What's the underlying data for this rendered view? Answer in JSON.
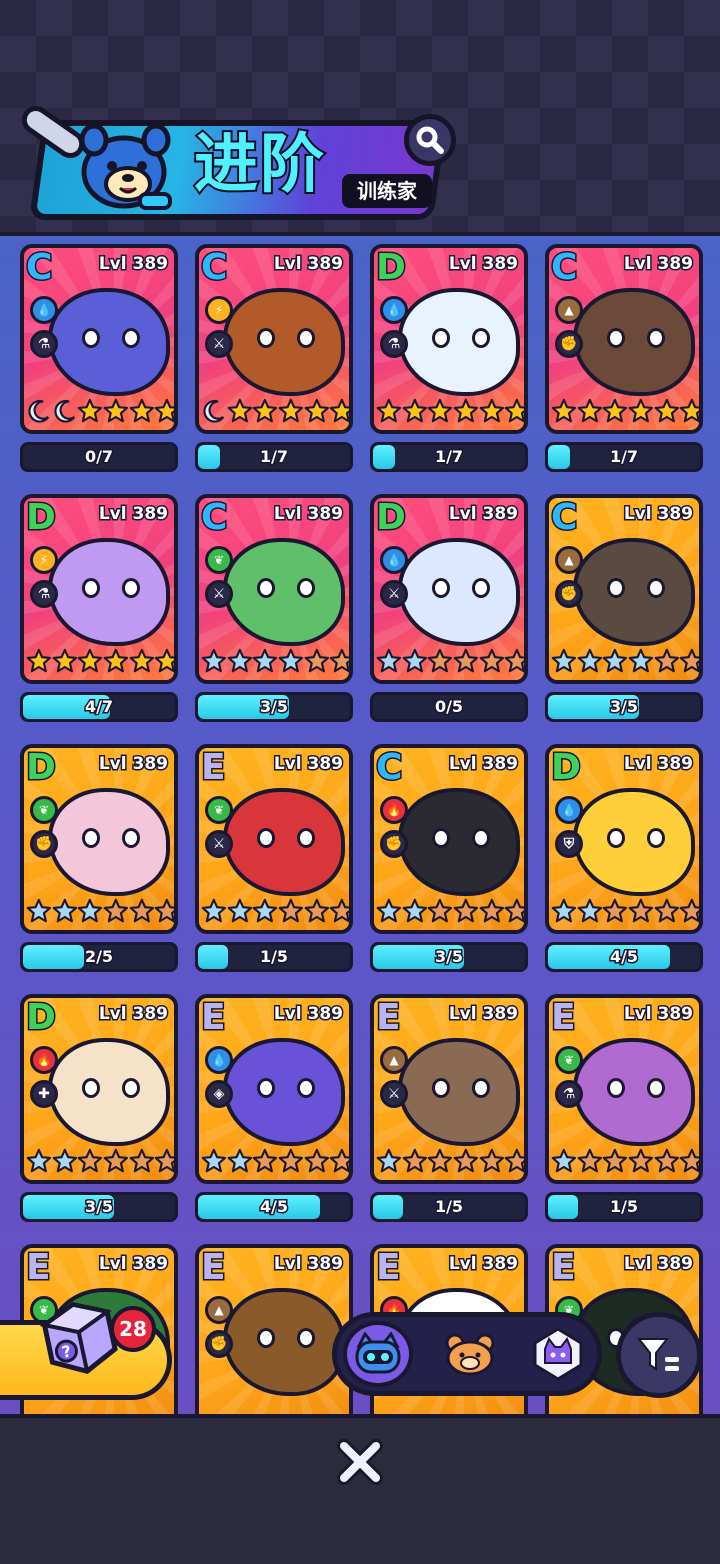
{
  "header": {
    "title": "进阶",
    "subtitle": "训练家",
    "search_icon": "search-icon"
  },
  "colors": {
    "rank_C": "#2fb6ff",
    "rank_D": "#3ed25a",
    "rank_E": "#b9b4ee",
    "water": "#2f8ee8",
    "electric": "#ffb21f",
    "earth": "#9a6b3c",
    "grass": "#38b94a",
    "fire": "#e8323b",
    "star_silver": "#a9d8f5",
    "star_gold": "#ffc21a",
    "star_bronze": "#e8995b",
    "progress_fill": "#3fdcf5"
  },
  "cards": [
    {
      "rank": "C",
      "level": "Lvl 389",
      "element": "water",
      "role": "potion",
      "style": "rare",
      "body": "#5a5fd8",
      "stars": [
        {
          "t": "moon"
        },
        {
          "t": "moon"
        },
        {
          "t": "gold"
        },
        {
          "t": "gold"
        },
        {
          "t": "gold"
        },
        {
          "t": "gold"
        }
      ],
      "progress_text": "0/7",
      "progress": 0.0
    },
    {
      "rank": "C",
      "level": "Lvl 389",
      "element": "electric",
      "role": "sword",
      "style": "rare",
      "body": "#b35a2a",
      "stars": [
        {
          "t": "moon"
        },
        {
          "t": "gold"
        },
        {
          "t": "gold"
        },
        {
          "t": "gold"
        },
        {
          "t": "gold"
        },
        {
          "t": "gold"
        }
      ],
      "progress_text": "1/7",
      "progress": 0.143
    },
    {
      "rank": "D",
      "level": "Lvl 389",
      "element": "water",
      "role": "potion",
      "style": "rare",
      "body": "#e9f2ff",
      "stars": [
        {
          "t": "gold"
        },
        {
          "t": "gold"
        },
        {
          "t": "gold"
        },
        {
          "t": "gold"
        },
        {
          "t": "gold"
        },
        {
          "t": "gold"
        }
      ],
      "progress_text": "1/7",
      "progress": 0.143
    },
    {
      "rank": "C",
      "level": "Lvl 389",
      "element": "earth",
      "role": "fist",
      "style": "rare",
      "body": "#6b4a3a",
      "stars": [
        {
          "t": "gold"
        },
        {
          "t": "gold"
        },
        {
          "t": "gold"
        },
        {
          "t": "gold"
        },
        {
          "t": "gold"
        },
        {
          "t": "gold"
        }
      ],
      "progress_text": "1/7",
      "progress": 0.143
    },
    {
      "rank": "D",
      "level": "Lvl 389",
      "element": "electric",
      "role": "potion",
      "style": "rare",
      "body": "#c09af0",
      "stars": [
        {
          "t": "gold"
        },
        {
          "t": "gold"
        },
        {
          "t": "gold"
        },
        {
          "t": "gold"
        },
        {
          "t": "gold"
        },
        {
          "t": "gold"
        }
      ],
      "progress_text": "4/7",
      "progress": 0.571
    },
    {
      "rank": "C",
      "level": "Lvl 389",
      "element": "grass",
      "role": "sword",
      "style": "rare",
      "body": "#5fbf6a",
      "stars": [
        {
          "t": "silver"
        },
        {
          "t": "silver"
        },
        {
          "t": "silver"
        },
        {
          "t": "silver"
        },
        {
          "t": "bronze"
        },
        {
          "t": "bronze"
        }
      ],
      "progress_text": "3/5",
      "progress": 0.6
    },
    {
      "rank": "D",
      "level": "Lvl 389",
      "element": "water",
      "role": "sword",
      "style": "rare",
      "body": "#dbe8ff",
      "stars": [
        {
          "t": "silver"
        },
        {
          "t": "silver"
        },
        {
          "t": "bronze"
        },
        {
          "t": "bronze"
        },
        {
          "t": "bronze"
        },
        {
          "t": "bronze"
        }
      ],
      "progress_text": "0/5",
      "progress": 0.0
    },
    {
      "rank": "C",
      "level": "Lvl 389",
      "element": "earth",
      "role": "fist",
      "style": "gold",
      "body": "#5b4a3f",
      "stars": [
        {
          "t": "silver"
        },
        {
          "t": "silver"
        },
        {
          "t": "silver"
        },
        {
          "t": "silver"
        },
        {
          "t": "bronze"
        },
        {
          "t": "bronze"
        }
      ],
      "progress_text": "3/5",
      "progress": 0.6
    },
    {
      "rank": "D",
      "level": "Lvl 389",
      "element": "grass",
      "role": "fist",
      "style": "gold",
      "body": "#f3c6d9",
      "stars": [
        {
          "t": "silver"
        },
        {
          "t": "silver"
        },
        {
          "t": "silver"
        },
        {
          "t": "bronze"
        },
        {
          "t": "bronze"
        },
        {
          "t": "bronze"
        }
      ],
      "progress_text": "2/5",
      "progress": 0.4
    },
    {
      "rank": "E",
      "level": "Lvl 389",
      "element": "grass",
      "role": "sword",
      "style": "gold",
      "body": "#d8363a",
      "stars": [
        {
          "t": "silver"
        },
        {
          "t": "silver"
        },
        {
          "t": "silver"
        },
        {
          "t": "bronze"
        },
        {
          "t": "bronze"
        },
        {
          "t": "bronze"
        }
      ],
      "progress_text": "1/5",
      "progress": 0.2
    },
    {
      "rank": "C",
      "level": "Lvl 389",
      "element": "fire",
      "role": "fist",
      "style": "gold",
      "body": "#2b2a33",
      "stars": [
        {
          "t": "silver"
        },
        {
          "t": "silver"
        },
        {
          "t": "bronze"
        },
        {
          "t": "bronze"
        },
        {
          "t": "bronze"
        },
        {
          "t": "bronze"
        }
      ],
      "progress_text": "3/5",
      "progress": 0.6
    },
    {
      "rank": "D",
      "level": "Lvl 389",
      "element": "water",
      "role": "shield",
      "style": "gold",
      "body": "#ffcf3a",
      "stars": [
        {
          "t": "silver"
        },
        {
          "t": "silver"
        },
        {
          "t": "bronze"
        },
        {
          "t": "bronze"
        },
        {
          "t": "bronze"
        },
        {
          "t": "bronze"
        }
      ],
      "progress_text": "4/5",
      "progress": 0.8
    },
    {
      "rank": "D",
      "level": "Lvl 389",
      "element": "fire",
      "role": "heal",
      "style": "gold",
      "body": "#f6e2c8",
      "stars": [
        {
          "t": "silver"
        },
        {
          "t": "silver"
        },
        {
          "t": "bronze"
        },
        {
          "t": "bronze"
        },
        {
          "t": "bronze"
        },
        {
          "t": "bronze"
        }
      ],
      "progress_text": "3/5",
      "progress": 0.6
    },
    {
      "rank": "E",
      "level": "Lvl 389",
      "element": "water",
      "role": "eye",
      "style": "gold",
      "body": "#6a52d8",
      "stars": [
        {
          "t": "silver"
        },
        {
          "t": "silver"
        },
        {
          "t": "bronze"
        },
        {
          "t": "bronze"
        },
        {
          "t": "bronze"
        },
        {
          "t": "bronze"
        }
      ],
      "progress_text": "4/5",
      "progress": 0.8
    },
    {
      "rank": "E",
      "level": "Lvl 389",
      "element": "earth",
      "role": "sword",
      "style": "gold",
      "body": "#8a6a52",
      "stars": [
        {
          "t": "silver"
        },
        {
          "t": "bronze"
        },
        {
          "t": "bronze"
        },
        {
          "t": "bronze"
        },
        {
          "t": "bronze"
        },
        {
          "t": "bronze"
        }
      ],
      "progress_text": "1/5",
      "progress": 0.2
    },
    {
      "rank": "E",
      "level": "Lvl 389",
      "element": "grass",
      "role": "potion",
      "style": "gold",
      "body": "#b06ad0",
      "stars": [
        {
          "t": "silver"
        },
        {
          "t": "bronze"
        },
        {
          "t": "bronze"
        },
        {
          "t": "bronze"
        },
        {
          "t": "bronze"
        },
        {
          "t": "bronze"
        }
      ],
      "progress_text": "1/5",
      "progress": 0.2
    },
    {
      "rank": "E",
      "level": "Lvl 389",
      "element": "grass",
      "role": "none",
      "style": "gold",
      "body": "#2d7a3a",
      "stars": [],
      "progress_text": "",
      "progress": null
    },
    {
      "rank": "E",
      "level": "Lvl 389",
      "element": "earth",
      "role": "fist",
      "style": "gold",
      "body": "#8a5a2a",
      "stars": [],
      "progress_text": "",
      "progress": null
    },
    {
      "rank": "E",
      "level": "Lvl 389",
      "element": "fire",
      "role": "none",
      "style": "gold",
      "body": "#ffffff",
      "stars": [],
      "progress_text": "",
      "progress": null
    },
    {
      "rank": "E",
      "level": "Lvl 389",
      "element": "grass",
      "role": "none",
      "style": "gold",
      "body": "#1e2a24",
      "stars": [],
      "progress_text": "",
      "progress": null
    }
  ],
  "chest": {
    "count": "28",
    "icon": "mystery-box-icon"
  },
  "tabs": [
    {
      "name": "tab-robot-cat",
      "icon": "robot-cat-icon",
      "active": true
    },
    {
      "name": "tab-bear",
      "icon": "bear-face-icon",
      "active": false
    },
    {
      "name": "tab-cat-gem",
      "icon": "cat-gem-icon",
      "active": false
    }
  ],
  "filter_icon": "filter-icon",
  "close_icon": "close-icon"
}
